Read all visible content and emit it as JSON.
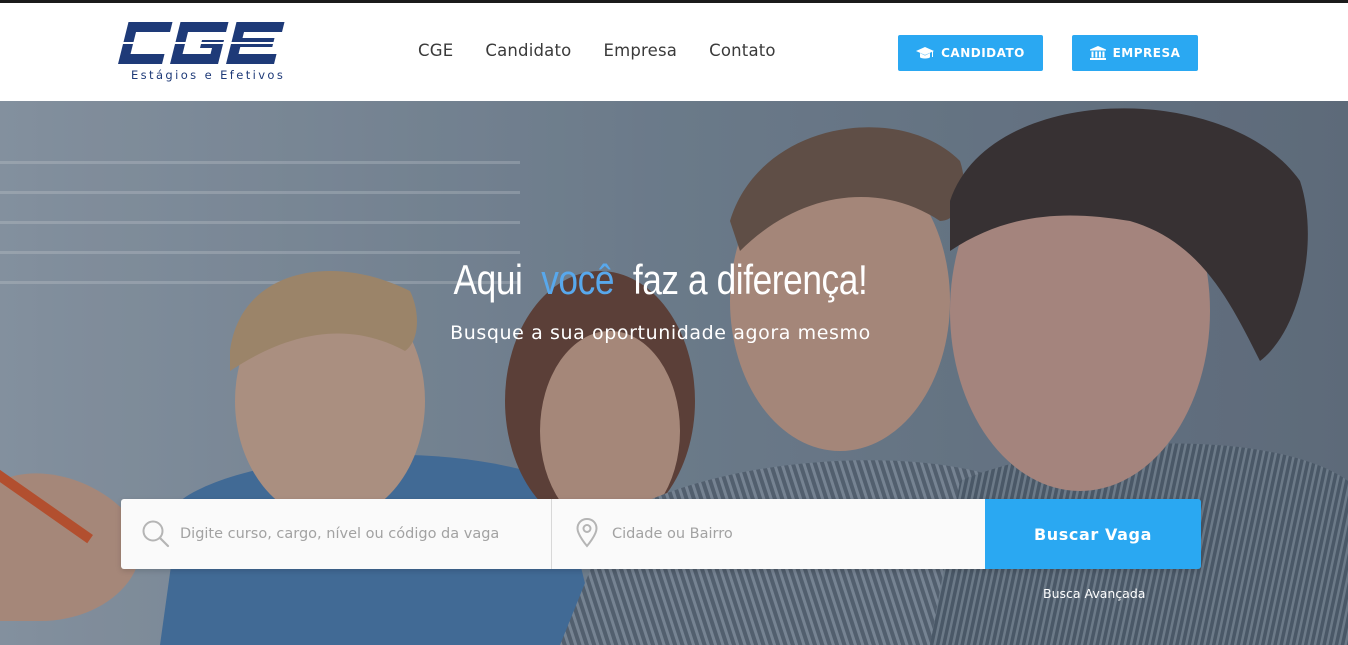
{
  "brand": {
    "logo_text": "CGE",
    "tagline": "Estágios e Efetivos",
    "logo_color": "#1e3a78"
  },
  "nav": {
    "links": [
      {
        "label": "CGE"
      },
      {
        "label": "Candidato"
      },
      {
        "label": "Empresa"
      },
      {
        "label": "Contato"
      }
    ]
  },
  "header_buttons": {
    "candidato": {
      "label": "CANDIDATO",
      "icon": "graduation-cap-icon"
    },
    "empresa": {
      "label": "EMPRESA",
      "icon": "bank-building-icon"
    }
  },
  "hero": {
    "headline_pre": "Aqui",
    "headline_highlight": "você",
    "headline_post": "faz a diferença!",
    "subheadline": "Busque a sua oportunidade agora mesmo"
  },
  "search": {
    "query_placeholder": "Digite curso, cargo, nível ou código da vaga",
    "query_value": "",
    "city_placeholder": "Cidade ou Bairro",
    "city_value": "",
    "button_label": "Buscar Vaga",
    "advanced_link": "Busca Avançada"
  },
  "colors": {
    "accent": "#2aa8f2",
    "highlight": "#58a8ec",
    "nav_text": "#3a3a3a"
  }
}
